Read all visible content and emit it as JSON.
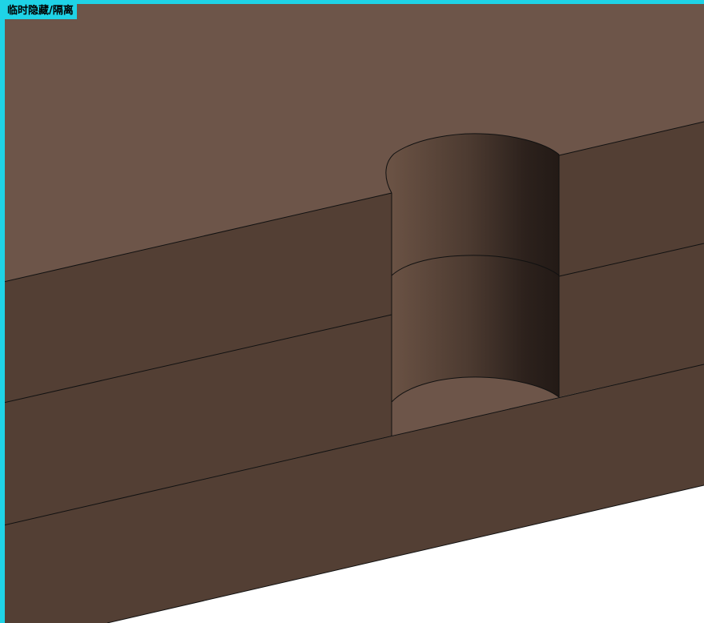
{
  "viewport": {
    "mode_label": "临时隐藏/隔离",
    "accent_color": "#1fd3e6"
  },
  "model": {
    "top_face_color": "#6d5549",
    "side_face_color": "#533f34",
    "bore_floor_color": "#6d5549",
    "edge_color": "#111111",
    "background_color": "#ffffff"
  }
}
